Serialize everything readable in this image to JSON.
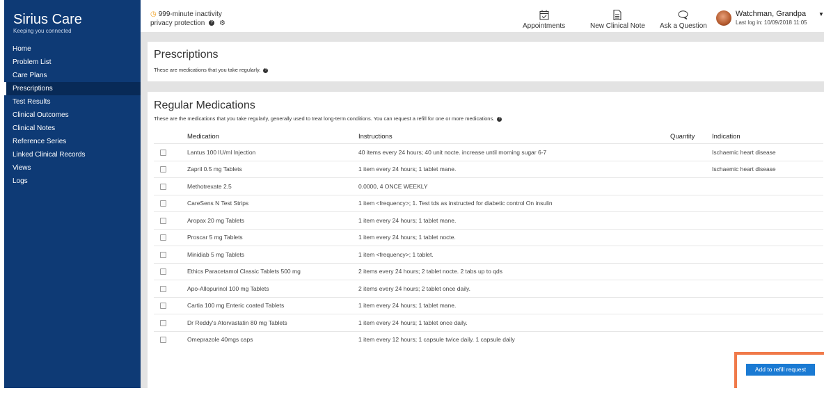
{
  "brand": {
    "title": "Sirius Care",
    "subtitle": "Keeping you connected"
  },
  "sidebar": {
    "items": [
      {
        "label": "Home"
      },
      {
        "label": "Problem List"
      },
      {
        "label": "Care Plans"
      },
      {
        "label": "Prescriptions",
        "active": true
      },
      {
        "label": "Test Results"
      },
      {
        "label": "Clinical Outcomes"
      },
      {
        "label": "Clinical Notes"
      },
      {
        "label": "Reference Series"
      },
      {
        "label": "Linked Clinical Records"
      },
      {
        "label": "Views"
      },
      {
        "label": "Logs"
      }
    ]
  },
  "topbar": {
    "inactivity": "999-minute inactivity",
    "privacy": "privacy protection",
    "actions": {
      "appointments": "Appointments",
      "new_note": "New Clinical Note",
      "ask": "Ask a Question"
    },
    "user": {
      "name": "Watchman, Grandpa",
      "last_login": "Last log in: 10/09/2018 11:05"
    }
  },
  "prescriptions_panel": {
    "title": "Prescriptions",
    "description": "These are medications that you take regularly."
  },
  "regular_panel": {
    "title": "Regular Medications",
    "description": "These are the medications that you take regularly, generally used to treat long-term conditions. You can request a refill for one or more medications.",
    "columns": {
      "medication": "Medication",
      "instructions": "Instructions",
      "quantity": "Quantity",
      "indication": "Indication"
    },
    "rows": [
      {
        "medication": "Lantus 100 IU/ml Injection",
        "instructions": "40 items every 24 hours; 40 unit nocte. increase until morning sugar 6-7",
        "quantity": "",
        "indication": "Ischaemic heart disease"
      },
      {
        "medication": "Zapril 0.5 mg Tablets",
        "instructions": "1 item every 24 hours; 1 tablet mane.",
        "quantity": "",
        "indication": "Ischaemic heart disease"
      },
      {
        "medication": "Methotrexate 2.5",
        "instructions": "0.0000, 4 ONCE WEEKLY",
        "quantity": "",
        "indication": ""
      },
      {
        "medication": "CareSens N Test Strips",
        "instructions": "1 item <frequency>; 1. Test tds as instructed for diabetic control On insulin",
        "quantity": "",
        "indication": ""
      },
      {
        "medication": "Aropax 20 mg Tablets",
        "instructions": "1 item every 24 hours; 1 tablet mane.",
        "quantity": "",
        "indication": ""
      },
      {
        "medication": "Proscar 5 mg Tablets",
        "instructions": "1 item every 24 hours; 1 tablet nocte.",
        "quantity": "",
        "indication": ""
      },
      {
        "medication": "Minidiab 5 mg Tablets",
        "instructions": "1 item <frequency>; 1 tablet.",
        "quantity": "",
        "indication": ""
      },
      {
        "medication": "Ethics Paracetamol Classic Tablets 500 mg",
        "instructions": "2 items every 24 hours; 2 tablet nocte. 2 tabs up to qds",
        "quantity": "",
        "indication": ""
      },
      {
        "medication": "Apo-Allopurinol 100 mg Tablets",
        "instructions": "2 items every 24 hours; 2 tablet once daily.",
        "quantity": "",
        "indication": ""
      },
      {
        "medication": "Cartia 100 mg Enteric coated Tablets",
        "instructions": "1 item every 24 hours; 1 tablet mane.",
        "quantity": "",
        "indication": ""
      },
      {
        "medication": "Dr Reddy's Atorvastatin 80 mg Tablets",
        "instructions": "1 item every 24 hours; 1 tablet once daily.",
        "quantity": "",
        "indication": ""
      },
      {
        "medication": "Omeprazole 40mgs caps",
        "instructions": "1 item every 12 hours; 1 capsule twice daily. 1 capsule daily",
        "quantity": "",
        "indication": ""
      }
    ],
    "refill_button": "Add to refill request"
  },
  "colors": {
    "sidebar_bg": "#0e3a75",
    "sidebar_active": "#082a57",
    "primary_button": "#1a7ad3",
    "highlight": "#f07a4a",
    "clock_icon": "#f0a020"
  },
  "icons": {
    "inactivity": "clock-icon",
    "privacy_help": "help-icon",
    "privacy_settings": "gear-icon",
    "appointments": "calendar-check-icon",
    "new_note": "document-icon",
    "ask": "speech-bubble-icon",
    "user_menu": "caret-down-icon"
  }
}
